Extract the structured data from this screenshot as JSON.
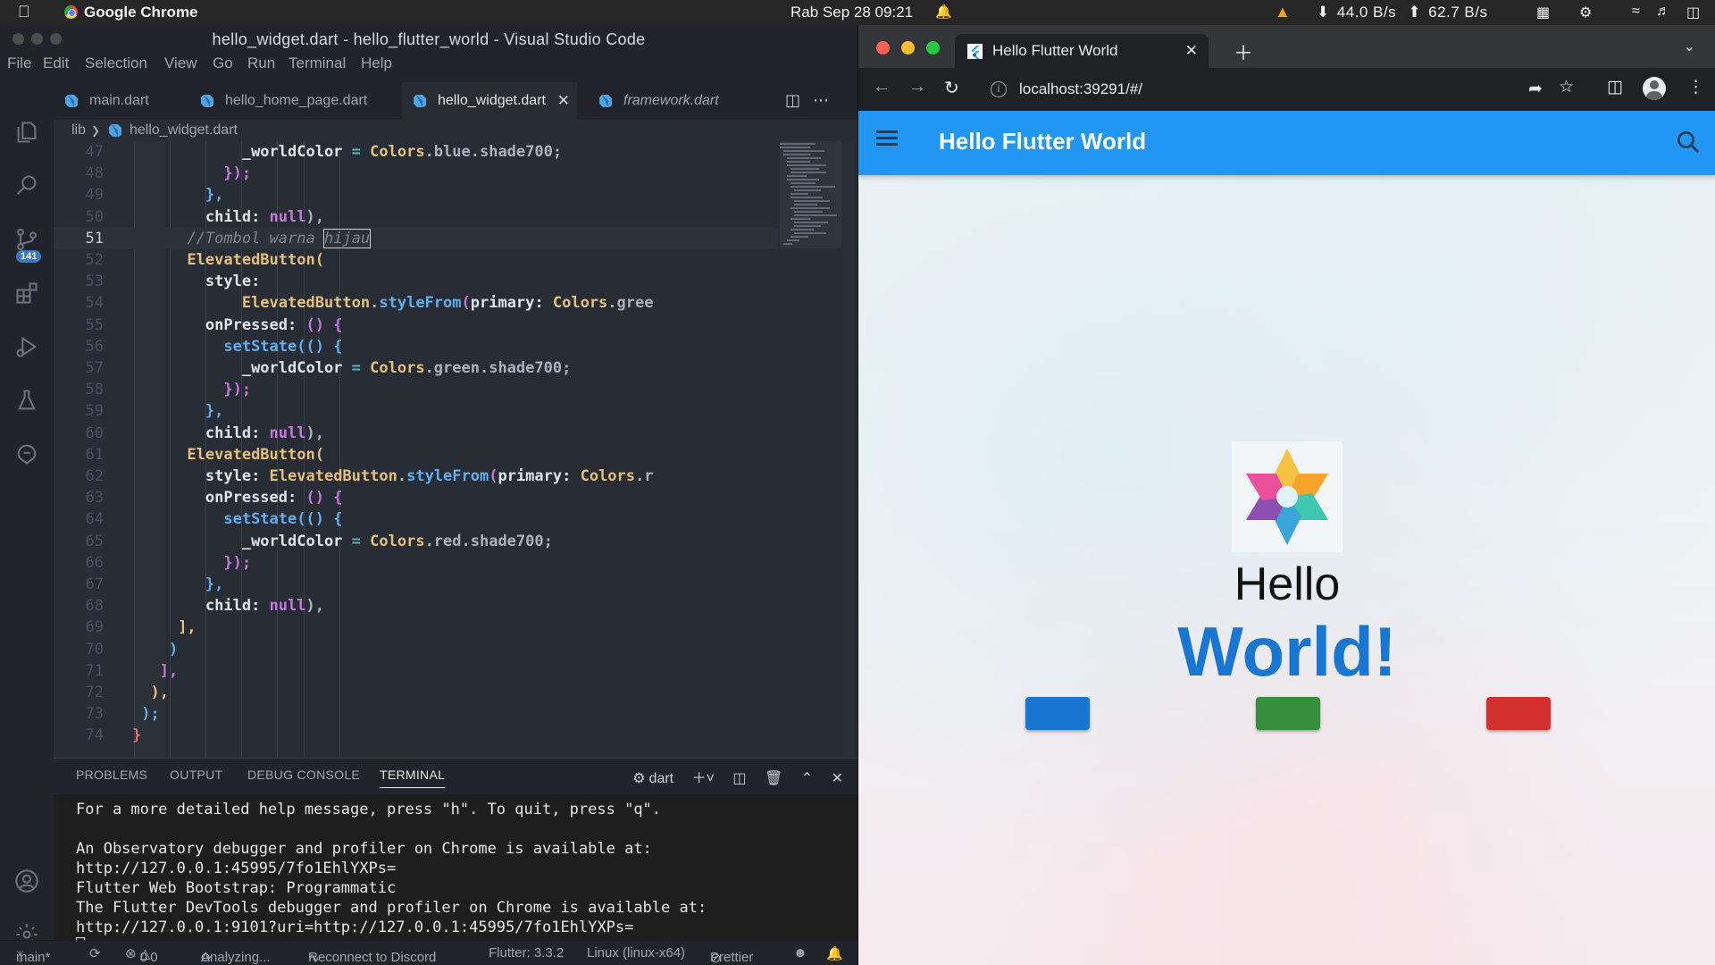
{
  "menubar": {
    "app_name": "Google Chrome",
    "datetime": "Rab Sep 28  09:21",
    "net_down": "44.0 B/s",
    "net_up": "62.7 B/s"
  },
  "vscode": {
    "window_title": "hello_widget.dart - hello_flutter_world - Visual Studio Code",
    "menu": [
      "File",
      "Edit",
      "Selection",
      "View",
      "Go",
      "Run",
      "Terminal",
      "Help"
    ],
    "scm_badge": "141",
    "tabs": [
      {
        "label": "main.dart"
      },
      {
        "label": "hello_home_page.dart"
      },
      {
        "label": "hello_widget.dart"
      },
      {
        "label": "framework.dart"
      }
    ],
    "breadcrumb": {
      "folder": "lib",
      "file": "hello_widget.dart"
    },
    "code_lines": [
      {
        "n": "47",
        "tokens": [
          [
            "",
            "            "
          ],
          [
            "var",
            "_worldColor"
          ],
          [
            "op",
            " = "
          ],
          [
            "cls",
            "Colors"
          ],
          [
            "",
            ".blue.shade700;"
          ]
        ]
      },
      {
        "n": "48",
        "tokens": [
          [
            "",
            "          "
          ],
          [
            "p2",
            "});"
          ]
        ]
      },
      {
        "n": "49",
        "tokens": [
          [
            "",
            "        "
          ],
          [
            "p3",
            "},"
          ]
        ]
      },
      {
        "n": "50",
        "tokens": [
          [
            "",
            "        "
          ],
          [
            "var",
            "child: "
          ],
          [
            "kw",
            "null"
          ],
          [
            "",
            "),"
          ]
        ]
      },
      {
        "n": "51",
        "tokens": [
          [
            "",
            "      "
          ],
          [
            "cm",
            "//Tombol warna "
          ],
          [
            "cmbox",
            "hijau"
          ]
        ]
      },
      {
        "n": "52",
        "tokens": [
          [
            "",
            "      "
          ],
          [
            "cls",
            "ElevatedButton"
          ],
          [
            "p1",
            "("
          ]
        ]
      },
      {
        "n": "53",
        "tokens": [
          [
            "",
            "        "
          ],
          [
            "var",
            "style:"
          ]
        ]
      },
      {
        "n": "54",
        "tokens": [
          [
            "",
            "            "
          ],
          [
            "cls",
            "ElevatedButton"
          ],
          [
            "",
            "."
          ],
          [
            "fn",
            "styleFrom"
          ],
          [
            "p2",
            "("
          ],
          [
            "var",
            "primary: "
          ],
          [
            "cls",
            "Colors"
          ],
          [
            "",
            ".gree"
          ]
        ]
      },
      {
        "n": "55",
        "tokens": [
          [
            "",
            "        "
          ],
          [
            "var",
            "onPressed: "
          ],
          [
            "p2",
            "()"
          ],
          [
            "",
            " "
          ],
          [
            "p2",
            "{"
          ]
        ]
      },
      {
        "n": "56",
        "tokens": [
          [
            "",
            "          "
          ],
          [
            "fn",
            "setState"
          ],
          [
            "p3",
            "(()"
          ],
          [
            "",
            " "
          ],
          [
            "p3",
            "{"
          ]
        ]
      },
      {
        "n": "57",
        "tokens": [
          [
            "",
            "            "
          ],
          [
            "var",
            "_worldColor"
          ],
          [
            "op",
            " = "
          ],
          [
            "cls",
            "Colors"
          ],
          [
            "",
            ".green.shade700;"
          ]
        ]
      },
      {
        "n": "58",
        "tokens": [
          [
            "",
            "          "
          ],
          [
            "p2",
            "});"
          ]
        ]
      },
      {
        "n": "59",
        "tokens": [
          [
            "",
            "        "
          ],
          [
            "p3",
            "},"
          ]
        ]
      },
      {
        "n": "60",
        "tokens": [
          [
            "",
            "        "
          ],
          [
            "var",
            "child: "
          ],
          [
            "kw",
            "null"
          ],
          [
            "",
            "),"
          ]
        ]
      },
      {
        "n": "61",
        "tokens": [
          [
            "",
            "      "
          ],
          [
            "cls",
            "ElevatedButton"
          ],
          [
            "p1",
            "("
          ]
        ]
      },
      {
        "n": "62",
        "tokens": [
          [
            "",
            "        "
          ],
          [
            "var",
            "style: "
          ],
          [
            "cls",
            "ElevatedButton"
          ],
          [
            "",
            "."
          ],
          [
            "fn",
            "styleFrom"
          ],
          [
            "p2",
            "("
          ],
          [
            "var",
            "primary: "
          ],
          [
            "cls",
            "Colors"
          ],
          [
            "",
            ".r"
          ]
        ]
      },
      {
        "n": "63",
        "tokens": [
          [
            "",
            "        "
          ],
          [
            "var",
            "onPressed: "
          ],
          [
            "p2",
            "()"
          ],
          [
            "",
            " "
          ],
          [
            "p2",
            "{"
          ]
        ]
      },
      {
        "n": "64",
        "tokens": [
          [
            "",
            "          "
          ],
          [
            "fn",
            "setState"
          ],
          [
            "p3",
            "(()"
          ],
          [
            "",
            " "
          ],
          [
            "p3",
            "{"
          ]
        ]
      },
      {
        "n": "65",
        "tokens": [
          [
            "",
            "            "
          ],
          [
            "var",
            "_worldColor"
          ],
          [
            "op",
            " = "
          ],
          [
            "cls",
            "Colors"
          ],
          [
            "",
            ".red.shade700;"
          ]
        ]
      },
      {
        "n": "66",
        "tokens": [
          [
            "",
            "          "
          ],
          [
            "p2",
            "});"
          ]
        ]
      },
      {
        "n": "67",
        "tokens": [
          [
            "",
            "        "
          ],
          [
            "p3",
            "},"
          ]
        ]
      },
      {
        "n": "68",
        "tokens": [
          [
            "",
            "        "
          ],
          [
            "var",
            "child: "
          ],
          [
            "kw",
            "null"
          ],
          [
            "",
            "),"
          ]
        ]
      },
      {
        "n": "69",
        "tokens": [
          [
            "",
            "     "
          ],
          [
            "p1",
            "],"
          ]
        ]
      },
      {
        "n": "70",
        "tokens": [
          [
            "",
            "    "
          ],
          [
            "p3",
            ")"
          ]
        ]
      },
      {
        "n": "71",
        "tokens": [
          [
            "",
            "   "
          ],
          [
            "p2",
            "],"
          ]
        ]
      },
      {
        "n": "72",
        "tokens": [
          [
            "",
            "  "
          ],
          [
            "p1",
            "),"
          ]
        ]
      },
      {
        "n": "73",
        "tokens": [
          [
            "",
            " "
          ],
          [
            "p3",
            ");"
          ]
        ]
      },
      {
        "n": "74",
        "tokens": [
          [
            "pk",
            "}"
          ]
        ]
      }
    ],
    "panel_tabs": [
      "PROBLEMS",
      "OUTPUT",
      "DEBUG CONSOLE",
      "TERMINAL"
    ],
    "terminal_shell": "dart",
    "terminal_lines": [
      "For a more detailed help message, press \"h\". To quit, press \"q\".",
      "",
      "An Observatory debugger and profiler on Chrome is available at:",
      "http://127.0.0.1:45995/7fo1EhlYXPs=",
      "Flutter Web Bootstrap: Programmatic",
      "The Flutter DevTools debugger and profiler on Chrome is available at:",
      "http://127.0.0.1:9101?uri=http://127.0.0.1:45995/7fo1EhlYXPs="
    ],
    "status": {
      "branch": "main*",
      "problems": "0",
      "warnings": "0",
      "analyzing": "Analyzing...",
      "discord": "Reconnect to Discord",
      "flutter": "Flutter: 3.3.2",
      "device": "Linux (linux-x64)",
      "prettier": "Prettier"
    }
  },
  "chrome": {
    "tab_title": "Hello Flutter World",
    "url": "localhost:39291/#/",
    "app": {
      "appbar_title": "Hello Flutter World",
      "hello": "Hello",
      "world": "World!",
      "buttons": [
        {
          "color": "#1976d2"
        },
        {
          "color": "#388e3c"
        },
        {
          "color": "#d32f2f"
        }
      ],
      "appbar_color": "#2196f3"
    }
  }
}
